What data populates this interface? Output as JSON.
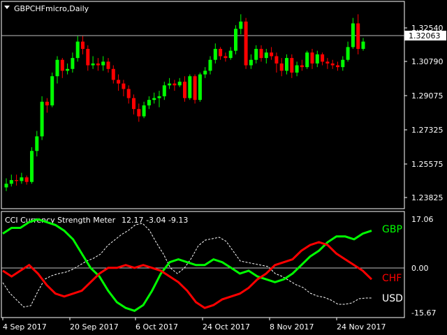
{
  "chart_title": "GBPCHFmicro,Daily",
  "current_price": "1.32063",
  "price_axis": [
    "1.32540",
    "1.30790",
    "1.29075",
    "1.27325",
    "1.25575",
    "1.23825"
  ],
  "indicator": {
    "name": "CCI Currency Strength Meter",
    "values_text": "12.17 -3.04 -9.13",
    "axis": [
      "17.06",
      "0.00",
      "-15.67"
    ],
    "labels": [
      {
        "text": "GBP",
        "color": "#00ff00"
      },
      {
        "text": "CHF",
        "color": "#ff0000"
      },
      {
        "text": "USD",
        "color": "#ffffff"
      }
    ]
  },
  "date_axis": [
    "4 Sep 2017",
    "20 Sep 2017",
    "6 Oct 2017",
    "24 Oct 2017",
    "8 Nov 2017",
    "24 Nov 2017"
  ],
  "colors": {
    "bull": "#00ff00",
    "bear": "#ff0000",
    "grid": "#ffffff",
    "bg": "#000000"
  },
  "chart_data": {
    "type": "candlestick",
    "candles": [
      [
        1.239,
        1.241,
        1.237,
        1.244
      ],
      [
        1.241,
        1.243,
        1.2395,
        1.246
      ],
      [
        1.243,
        1.2425,
        1.24,
        1.246
      ],
      [
        1.2425,
        1.2445,
        1.241,
        1.247
      ],
      [
        1.2445,
        1.242,
        1.2405,
        1.2455
      ],
      [
        1.242,
        1.259,
        1.241,
        1.261
      ],
      [
        1.259,
        1.267,
        1.256,
        1.27
      ],
      [
        1.267,
        1.286,
        1.265,
        1.289
      ],
      [
        1.286,
        1.284,
        1.28,
        1.288
      ],
      [
        1.284,
        1.3,
        1.283,
        1.302
      ],
      [
        1.3,
        1.309,
        1.296,
        1.311
      ],
      [
        1.309,
        1.303,
        1.299,
        1.31
      ],
      [
        1.303,
        1.304,
        1.301,
        1.307
      ],
      [
        1.304,
        1.31,
        1.302,
        1.313
      ],
      [
        1.31,
        1.319,
        1.308,
        1.322
      ],
      [
        1.319,
        1.315,
        1.312,
        1.322
      ],
      [
        1.315,
        1.306,
        1.303,
        1.317
      ],
      [
        1.306,
        1.307,
        1.304,
        1.311
      ],
      [
        1.307,
        1.306,
        1.303,
        1.31
      ],
      [
        1.306,
        1.308,
        1.303,
        1.311
      ],
      [
        1.308,
        1.304,
        1.302,
        1.31
      ],
      [
        1.304,
        1.298,
        1.296,
        1.306
      ],
      [
        1.298,
        1.296,
        1.292,
        1.301
      ],
      [
        1.296,
        1.293,
        1.289,
        1.298
      ],
      [
        1.293,
        1.288,
        1.285,
        1.295
      ],
      [
        1.288,
        1.282,
        1.279,
        1.29
      ],
      [
        1.282,
        1.278,
        1.275,
        1.285
      ],
      [
        1.278,
        1.284,
        1.277,
        1.286
      ],
      [
        1.284,
        1.287,
        1.282,
        1.289
      ],
      [
        1.287,
        1.288,
        1.285,
        1.291
      ],
      [
        1.288,
        1.289,
        1.283,
        1.292
      ],
      [
        1.289,
        1.295,
        1.287,
        1.297
      ],
      [
        1.295,
        1.296,
        1.293,
        1.299
      ],
      [
        1.296,
        1.295,
        1.292,
        1.298
      ],
      [
        1.295,
        1.297,
        1.294,
        1.299
      ],
      [
        1.297,
        1.288,
        1.286,
        1.3
      ],
      [
        1.288,
        1.3,
        1.287,
        1.301
      ],
      [
        1.3,
        1.287,
        1.285,
        1.301
      ],
      [
        1.287,
        1.301,
        1.286,
        1.302
      ],
      [
        1.301,
        1.303,
        1.299,
        1.305
      ],
      [
        1.303,
        1.309,
        1.301,
        1.311
      ],
      [
        1.309,
        1.315,
        1.307,
        1.318
      ],
      [
        1.315,
        1.311,
        1.309,
        1.316
      ],
      [
        1.311,
        1.31,
        1.308,
        1.313
      ],
      [
        1.31,
        1.314,
        1.309,
        1.316
      ],
      [
        1.314,
        1.326,
        1.312,
        1.328
      ],
      [
        1.326,
        1.33,
        1.323,
        1.334
      ],
      [
        1.33,
        1.306,
        1.304,
        1.332
      ],
      [
        1.306,
        1.309,
        1.304,
        1.312
      ],
      [
        1.309,
        1.315,
        1.307,
        1.317
      ],
      [
        1.315,
        1.31,
        1.308,
        1.317
      ],
      [
        1.31,
        1.313,
        1.307,
        1.315
      ],
      [
        1.313,
        1.311,
        1.309,
        1.316
      ],
      [
        1.311,
        1.307,
        1.302,
        1.313
      ],
      [
        1.307,
        1.303,
        1.3,
        1.31
      ],
      [
        1.303,
        1.31,
        1.301,
        1.312
      ],
      [
        1.31,
        1.302,
        1.299,
        1.312
      ],
      [
        1.302,
        1.306,
        1.3,
        1.308
      ],
      [
        1.306,
        1.305,
        1.303,
        1.309
      ],
      [
        1.305,
        1.313,
        1.304,
        1.314
      ],
      [
        1.313,
        1.307,
        1.304,
        1.315
      ],
      [
        1.307,
        1.312,
        1.305,
        1.314
      ],
      [
        1.312,
        1.308,
        1.306,
        1.313
      ],
      [
        1.308,
        1.307,
        1.304,
        1.31
      ],
      [
        1.307,
        1.306,
        1.304,
        1.309
      ],
      [
        1.306,
        1.305,
        1.303,
        1.308
      ],
      [
        1.305,
        1.309,
        1.303,
        1.311
      ],
      [
        1.309,
        1.316,
        1.308,
        1.319
      ],
      [
        1.316,
        1.329,
        1.315,
        1.332
      ],
      [
        1.329,
        1.315,
        1.312,
        1.334
      ],
      [
        1.315,
        1.319,
        1.314,
        1.321
      ]
    ],
    "ymin": 1.23,
    "ymax": 1.338,
    "strength": {
      "GBP": [
        12,
        14,
        14,
        16,
        17,
        16,
        15,
        13,
        10,
        5,
        0,
        -3,
        -8,
        -12,
        -14,
        -15,
        -13,
        -8,
        -2,
        2,
        3,
        2,
        1,
        1,
        3,
        2,
        0,
        -2,
        -1,
        -3,
        -4,
        -5,
        -4,
        -2,
        1,
        4,
        6,
        9,
        11,
        11,
        10,
        12,
        13
      ],
      "CHF": [
        -1,
        -3,
        -1,
        1,
        -2,
        -6,
        -9,
        -10,
        -9,
        -8,
        -5,
        -2,
        0,
        0,
        1,
        0,
        1,
        0,
        -1,
        -3,
        -5,
        -8,
        -12,
        -14,
        -13,
        -11,
        -10,
        -9,
        -7,
        -4,
        -2,
        1,
        2,
        3,
        6,
        8,
        9,
        8,
        5,
        3,
        1,
        -1,
        -4
      ]
    },
    "strength_range": [
      -15.67,
      17.06
    ]
  }
}
